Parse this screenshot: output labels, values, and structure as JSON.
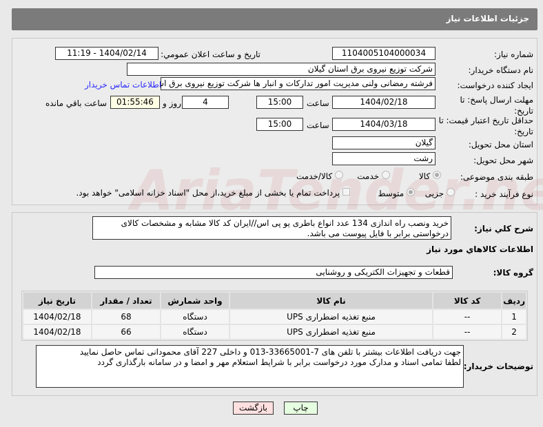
{
  "header": {
    "title": "جزئیات اطلاعات نیاز"
  },
  "form": {
    "need_number_label": "شماره نیاز:",
    "need_number": "1104005104000034",
    "announce_label": "تاریخ و ساعت اعلان عمومي:",
    "announce_value": "1404/02/14 - 11:19",
    "buyer_org_label": "نام دستگاه خریدار:",
    "buyer_org": "شرکت توزیع نیروی برق استان گیلان",
    "creator_label": "ایجاد کننده درخواست:",
    "creator": "فرشته رمضانی ولنی مدیریت امور تدارکات و انبار ها شرکت توزیع نیروی برق استان گیلان",
    "contact_link": "اطلاعات تماس خریدار",
    "deadline_label": "مهلت ارسال پاسخ: تا تاریخ:",
    "deadline_date": "1404/02/18",
    "time_label": "ساعت",
    "deadline_time": "15:00",
    "days": "4",
    "days_label": "روز و",
    "remaining": "01:55:46",
    "remaining_label": "ساعت باقي مانده",
    "validity_label": "حداقل تاریخ اعتبار قیمت: تا تاریخ:",
    "validity_date": "1404/03/18",
    "validity_time": "15:00",
    "province_label": "استان محل تحویل:",
    "province": "گیلان",
    "city_label": "شهر محل تحویل:",
    "city": "رشت",
    "category_label": "طبقه بندی موضوعی:",
    "category_options": [
      "کالا",
      "خدمت",
      "کالا/خدمت"
    ],
    "process_label": "نوع فرآیند خرید :",
    "process_options": [
      "جزیی",
      "متوسط"
    ],
    "payment_note": "پرداخت تمام یا بخشی از مبلغ خرید،از محل \"اسناد خزانه اسلامی\" خواهد بود."
  },
  "details": {
    "summary_label": "شرح کلي نیاز:",
    "summary": "خرید ونصب راه اندازی 134 عدد انواع باطری یو پی اس//ایران کد کالا مشابه و مشخصات کالای درخواستی برابر با فایل پیوست می باشد.",
    "goods_title": "اطلاعات کالاهاي مورد نیاز",
    "group_label": "گروه کالا:",
    "group": "قطعات و تجهیزات الکتریکی و روشنایی",
    "columns": [
      "ردیف",
      "کد کالا",
      "نام کالا",
      "واحد شمارش",
      "تعداد / مقدار",
      "تاریخ نیاز"
    ],
    "rows": [
      [
        "1",
        "--",
        "منبع تغذیه اضطراری UPS",
        "دستگاه",
        "68",
        "1404/02/18"
      ],
      [
        "2",
        "--",
        "منبع تغذیه اضطراری UPS",
        "دستگاه",
        "66",
        "1404/02/18"
      ]
    ],
    "notes_label": "توضیحات خریدار:",
    "notes": "جهت دریافت اطلاعات بیشتر با تلفن های 7-33665001-013 و داخلی 227 آقای محمودانی تماس حاصل نمایید\nلطفا تمامی اسناد و مدارک مورد درخواست برابر با شرایط استعلام مهر و امضا و در سامانه بارگذاری گردد"
  },
  "buttons": {
    "print": "چاپ",
    "back": "بازگشت"
  },
  "watermark": "AriaTender.net"
}
